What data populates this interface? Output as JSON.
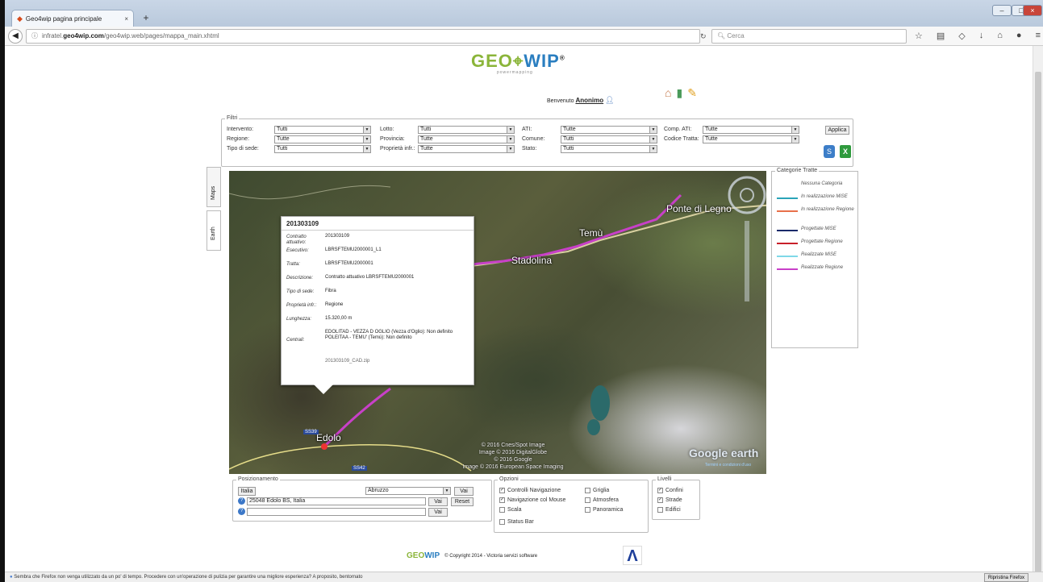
{
  "browser": {
    "tab_title": "Geo4wip pagina principale",
    "url_prefix": "infratel.",
    "url_domain": "geo4wip.com",
    "url_path": "/geo4wip.web/pages/mappa_main.xhtml",
    "search_placeholder": "Cerca",
    "notification": "Sembra che Firefox non venga utilizzato da un po' di tempo. Procedere con un'operazione di pulizia per garantire una migliore esperienza? A proposito, bentornato",
    "notification_button": "Ripristina Firefox"
  },
  "header": {
    "logo_geo": "GEO",
    "logo_wip": "WIP",
    "logo_sub": "powermapping",
    "welcome_label": "Benvenuto",
    "username": "Anonimo"
  },
  "filters": {
    "legend": "Filtri",
    "intervento_label": "Intervento:",
    "intervento_value": "Tutti",
    "regione_label": "Regione:",
    "regione_value": "Tutte",
    "tipo_sede_label": "Tipo di sede:",
    "tipo_sede_value": "Tutti",
    "lotto_label": "Lotto:",
    "lotto_value": "Tutti",
    "provincia_label": "Provincia:",
    "provincia_value": "Tutte",
    "proprieta_label": "Proprietà infr.:",
    "proprieta_value": "Tutte",
    "ati_label": "ATI:",
    "ati_value": "Tutte",
    "comune_label": "Comune:",
    "comune_value": "Tutti",
    "stato_label": "Stato:",
    "stato_value": "Tutti",
    "comp_ati_label": "Comp. ATI:",
    "comp_ati_value": "Tutte",
    "codice_tratta_label": "Codice Tratta:",
    "codice_tratta_value": "Tutte",
    "apply_label": "Applica"
  },
  "side_tabs": {
    "maps": "Maps",
    "earth": "Earth"
  },
  "map": {
    "labels": {
      "ponte": "Ponte di Legno",
      "temu": "Temù",
      "stadolina": "Stadolina",
      "edolo": "Edolo",
      "ss39": "SS39",
      "ss42": "SS42"
    },
    "copyright": [
      "© 2016 Cnes/Spot Image",
      "Image © 2016 DigitalGlobe",
      "© 2016 Google",
      "Image © 2016 European Space Imaging"
    ],
    "google_earth": "Google earth",
    "terms": "Termini e condizioni d'uso"
  },
  "popup": {
    "title": "201303109",
    "rows": [
      {
        "k": "Contratto attuativo:",
        "v": "201303109"
      },
      {
        "k": "Esecutivo:",
        "v": "LBRSFTEMU2000001_L1"
      },
      {
        "k": "Tratta:",
        "v": "LBRSFTEMU2000001"
      },
      {
        "k": "Descrizione:",
        "v": "Contratto attuativo LBRSFTEMU2000001"
      },
      {
        "k": "Tipo di sede:",
        "v": "Fibra"
      },
      {
        "k": "Proprietà infr.:",
        "v": "Regione"
      },
      {
        "k": "Lunghezza:",
        "v": "15.320,00 m"
      },
      {
        "k": "Centrali:",
        "v": "EDOLITAD - VEZZA D OGLIO (Vezza d'Oglio): Non definito POLEITAA - TEMU' (Temù): Non definito"
      },
      {
        "k": "",
        "v": "201303109_CAD.zip"
      }
    ]
  },
  "categorie": {
    "legend": "Categorie Tratte",
    "items": [
      {
        "label": "Nessuna Categoria",
        "color": ""
      },
      {
        "label": "In realizzazione MiSE",
        "color": "#2aa4b8"
      },
      {
        "label": "In realizzazione Regione",
        "color": "#e8704a"
      },
      {
        "label": "Progettate MiSE",
        "color": "#1a2a6a"
      },
      {
        "label": "Progettate Regione",
        "color": "#c8202a"
      },
      {
        "label": "Realizzate MiSE",
        "color": "#7fd8e8"
      },
      {
        "label": "Realizzate Regione",
        "color": "#c840c8"
      }
    ]
  },
  "posizionamento": {
    "legend": "Posizionamento",
    "italia_button": "Italia",
    "region_value": "Abruzzo",
    "vai1": "Vai",
    "address_value": "25048 Edolo BS, Italia",
    "vai2": "Vai",
    "reset": "Reset",
    "coord_value": "",
    "vai3": "Vai"
  },
  "opzioni": {
    "legend": "Opzioni",
    "items": [
      {
        "label": "Controlli Navigazione",
        "checked": "✓"
      },
      {
        "label": "Griglia",
        "checked": ""
      },
      {
        "label": "Navigazione col Mouse",
        "checked": "✓"
      },
      {
        "label": "Atmosfera",
        "checked": ""
      },
      {
        "label": "Scala",
        "checked": ""
      },
      {
        "label": "Panoramica",
        "checked": ""
      },
      {
        "label": "Status Bar",
        "checked": ""
      }
    ]
  },
  "livelli": {
    "legend": "Livelli",
    "items": [
      {
        "label": "Confini",
        "checked": "✓"
      },
      {
        "label": "Strade",
        "checked": "✓"
      },
      {
        "label": "Edifici",
        "checked": ""
      }
    ]
  },
  "footer": {
    "logo_geo": "GEO",
    "logo_wip": "WIP",
    "copyright": "© Copyright 2014 - Victoria servizi software"
  }
}
